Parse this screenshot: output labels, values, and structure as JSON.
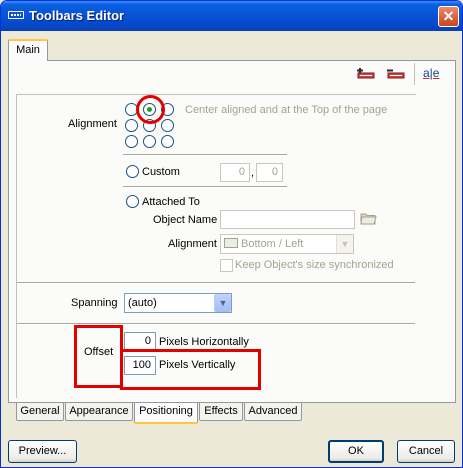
{
  "window": {
    "title": "Toolbars Editor",
    "close_glyph": "✕"
  },
  "tabs_top": [
    {
      "label": "Main"
    }
  ],
  "toolbar_icons": [
    "add-toolbar-icon",
    "remove-toolbar-icon",
    "text-format-icon"
  ],
  "toolbar_icon_text": "a|e",
  "alignment": {
    "label": "Alignment",
    "description": "Center aligned and at the Top of the page",
    "custom_label": "Custom",
    "custom_x": "0",
    "custom_y": "0",
    "comma": ",",
    "attached_label": "Attached To",
    "object_name_label": "Object Name",
    "object_name_value": "",
    "attached_alignment_label": "Alignment",
    "attached_alignment_value": "Bottom / Left",
    "keep_size_label": "Keep Object's size synchronized"
  },
  "spanning": {
    "label": "Spanning",
    "value": "(auto)"
  },
  "offset": {
    "label": "Offset",
    "horizontal_value": "0",
    "horizontal_label": "Pixels Horizontally",
    "vertical_value": "100",
    "vertical_label": "Pixels Vertically"
  },
  "tabs_bottom": [
    {
      "label": "General"
    },
    {
      "label": "Appearance"
    },
    {
      "label": "Positioning"
    },
    {
      "label": "Effects"
    },
    {
      "label": "Advanced"
    }
  ],
  "buttons": {
    "preview": "Preview...",
    "ok": "OK",
    "cancel": "Cancel"
  },
  "colors": {
    "title_bar": "#0752d8",
    "highlight": "#e50000",
    "selected_radio": "#21a121"
  }
}
